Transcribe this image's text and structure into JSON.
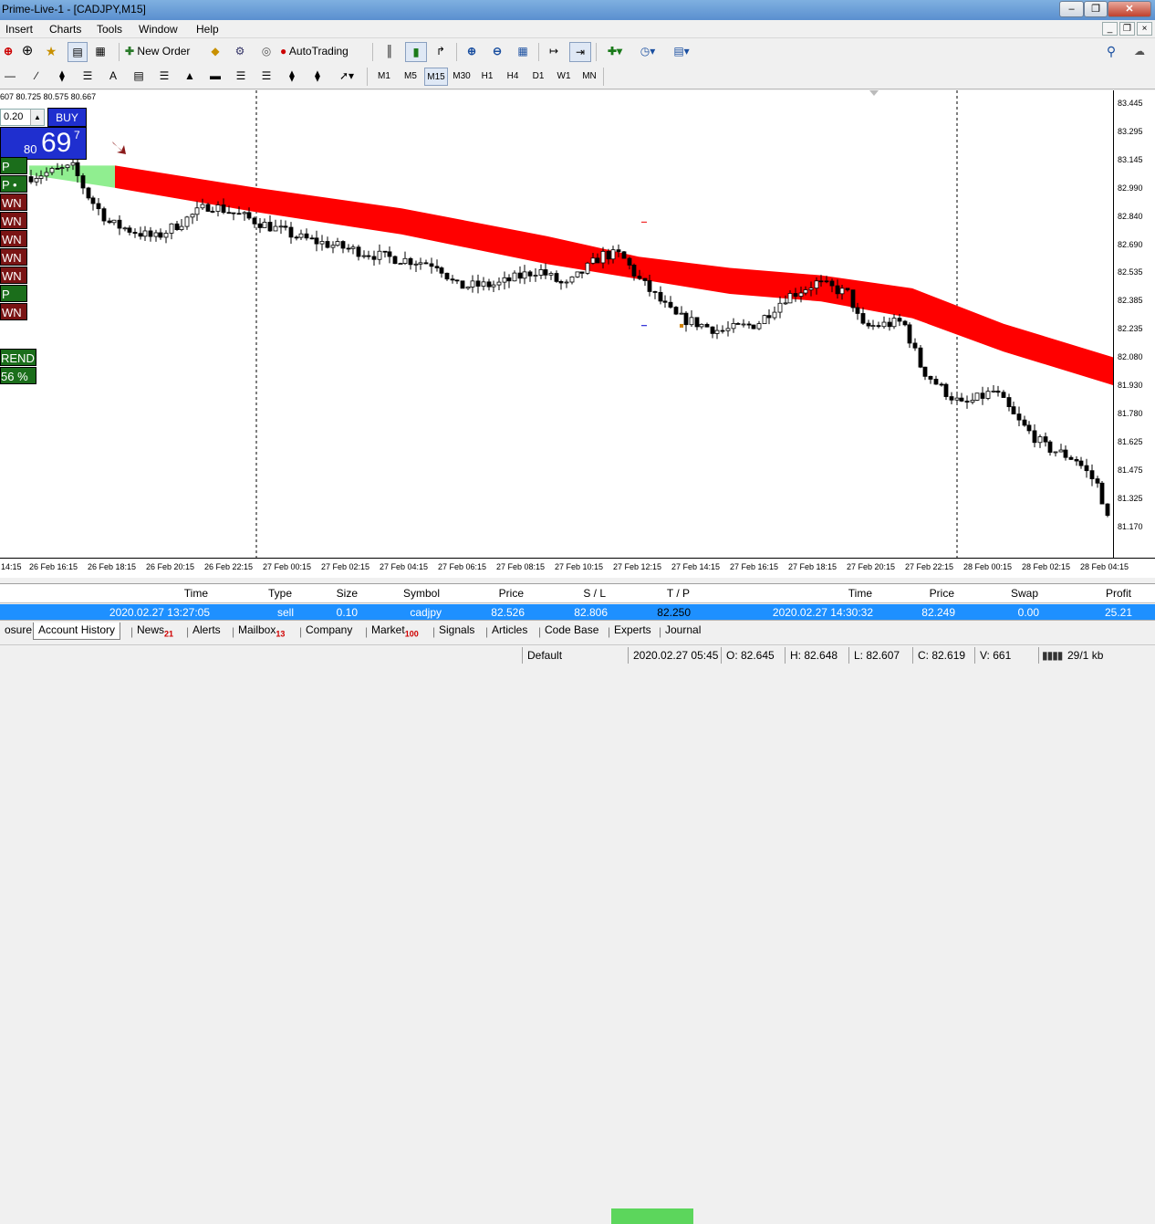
{
  "window": {
    "title": "Prime-Live-1 - [CADJPY,M15]",
    "min_icon": "minimize-icon",
    "max_icon": "restore-icon",
    "close_icon": "close-icon"
  },
  "menu": [
    "Insert",
    "Charts",
    "Tools",
    "Window",
    "Help"
  ],
  "toolbar": {
    "new_order": "New Order",
    "auto_trading": "AutoTrading",
    "timeframes": [
      "M1",
      "M5",
      "M15",
      "M30",
      "H1",
      "H4",
      "D1",
      "W1",
      "MN"
    ],
    "active_timeframe": "M15",
    "text_tool": "A"
  },
  "chart": {
    "ohlc_line": "607 80.725 80.575 80.667",
    "lot_value": "0.20",
    "buy_label": "BUY",
    "price_small": "80",
    "price_big": "69",
    "price_sup": "7",
    "signals": [
      {
        "label": "P",
        "kind": "up"
      },
      {
        "label": "P •",
        "kind": "up"
      },
      {
        "label": "WN",
        "kind": "dn"
      },
      {
        "label": "WN",
        "kind": "dn"
      },
      {
        "label": "WN",
        "kind": "dn"
      },
      {
        "label": "WN",
        "kind": "dn"
      },
      {
        "label": "WN",
        "kind": "dn"
      },
      {
        "label": "P",
        "kind": "up"
      },
      {
        "label": "WN",
        "kind": "dn"
      }
    ],
    "trend_label": "REND",
    "trend_pct": "56 %",
    "price_axis": [
      "83.445",
      "83.295",
      "83.145",
      "82.990",
      "82.840",
      "82.690",
      "82.535",
      "82.385",
      "82.235",
      "82.080",
      "81.930",
      "81.780",
      "81.625",
      "81.475",
      "81.325",
      "81.170"
    ],
    "time_axis": [
      "14:15",
      "26 Feb 16:15",
      "26 Feb 18:15",
      "26 Feb 20:15",
      "26 Feb 22:15",
      "27 Feb 00:15",
      "27 Feb 02:15",
      "27 Feb 04:15",
      "27 Feb 06:15",
      "27 Feb 08:15",
      "27 Feb 10:15",
      "27 Feb 12:15",
      "27 Feb 14:15",
      "27 Feb 16:15",
      "27 Feb 18:15",
      "27 Feb 20:15",
      "27 Feb 22:15",
      "28 Feb 00:15",
      "28 Feb 02:15",
      "28 Feb 04:15"
    ],
    "band_colors": {
      "up": "#90ee90",
      "down": "#ff0000"
    }
  },
  "history": {
    "headers": [
      "Time",
      "Type",
      "Size",
      "Symbol",
      "Price",
      "S / L",
      "T / P",
      "Time",
      "Price",
      "Swap",
      "Profit"
    ],
    "row": [
      "2020.02.27 13:27:05",
      "sell",
      "0.10",
      "cadjpy",
      "82.526",
      "82.806",
      "82.250",
      "2020.02.27 14:30:32",
      "82.249",
      "0.00",
      "25.21"
    ]
  },
  "tabs": [
    {
      "label": "osure",
      "badge": ""
    },
    {
      "label": "Account History",
      "badge": ""
    },
    {
      "label": "News",
      "badge": "21"
    },
    {
      "label": "Alerts",
      "badge": ""
    },
    {
      "label": "Mailbox",
      "badge": "13"
    },
    {
      "label": "Company",
      "badge": ""
    },
    {
      "label": "Market",
      "badge": "100"
    },
    {
      "label": "Signals",
      "badge": ""
    },
    {
      "label": "Articles",
      "badge": ""
    },
    {
      "label": "Code Base",
      "badge": ""
    },
    {
      "label": "Experts",
      "badge": ""
    },
    {
      "label": "Journal",
      "badge": ""
    }
  ],
  "status": {
    "profile": "Default",
    "datetime": "2020.02.27 05:45",
    "open": "O: 82.645",
    "high": "H: 82.648",
    "low": "L: 82.607",
    "close": "C: 82.619",
    "volume": "V: 661",
    "traffic": "29/1 kb"
  }
}
